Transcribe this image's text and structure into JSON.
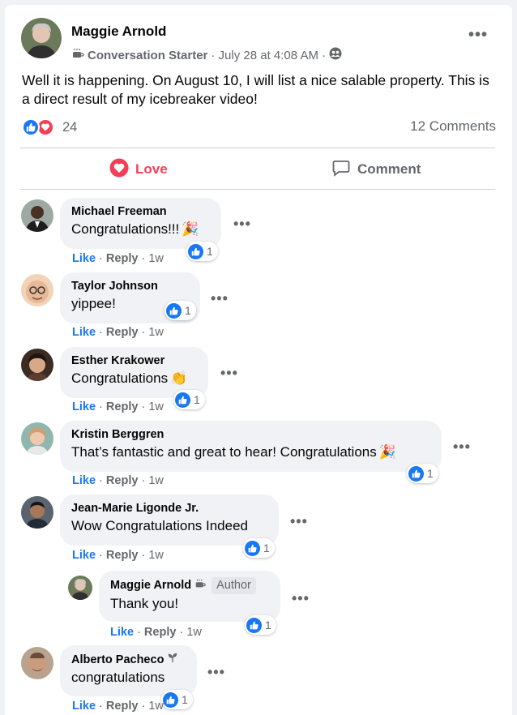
{
  "post": {
    "author": "Maggie Arnold",
    "badge": "Conversation Starter",
    "time": "· July 28 at 4:08 AM ·",
    "text": "Well it is happening. On August 10, I will list a nice salable property. This is a direct result of my icebreaker video!",
    "reaction_count": "24",
    "comments_count": "12 Comments"
  },
  "actions": {
    "love": "Love",
    "comment": "Comment"
  },
  "comment_labels": {
    "like": "Like",
    "reply": "Reply",
    "sep": "·"
  },
  "comments": [
    {
      "name": "Michael Freeman",
      "text": "Congratulations!!!",
      "time": "1w",
      "likes": "1",
      "emoji": "party"
    },
    {
      "name": "Taylor Johnson",
      "text": "yippee!",
      "time": "1w",
      "likes": "1"
    },
    {
      "name": "Esther Krakower",
      "text": "Congratulations",
      "time": "1w",
      "likes": "1",
      "emoji": "clap"
    },
    {
      "name": "Kristin Berggren",
      "text": "That’s fantastic and great to hear! Congratulations",
      "time": "1w",
      "likes": "1",
      "emoji": "party"
    },
    {
      "name": "Jean-Marie Ligonde Jr.",
      "text": "Wow Congratulations Indeed",
      "time": "1w",
      "likes": "1"
    },
    {
      "name": "Maggie Arnold",
      "author_tag": "Author",
      "text": "Thank you!",
      "time": "1w",
      "likes": "1",
      "reply": true
    },
    {
      "name": "Alberto Pacheco",
      "text": "congratulations",
      "time": "1w",
      "likes": "1"
    }
  ],
  "colors": {
    "accent": "#1877f2",
    "love": "#f33e58",
    "bubble": "#f0f2f5",
    "muted": "#65676b"
  },
  "icons": [
    "coffee-cup-icon",
    "friends-audience-icon",
    "like-icon",
    "love-icon",
    "comment-icon",
    "more-options-icon",
    "party-popper-icon",
    "clapping-hands-icon",
    "seedling-icon"
  ]
}
